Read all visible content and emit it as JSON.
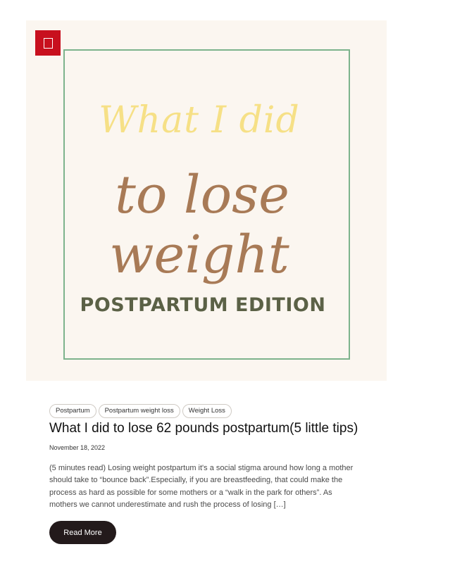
{
  "hero": {
    "line1": "What I did",
    "line2": "to lose",
    "line3": "weight",
    "line4": "POSTPARTUM EDITION",
    "badge_icon": "format-standard-icon",
    "colors": {
      "background": "#fbf6f0",
      "frame": "#7db38c",
      "line1": "#f6e086",
      "line2": "#a87a56",
      "line4": "#5b6146",
      "badge": "#c8101e"
    }
  },
  "post": {
    "tags": [
      "Postpartum",
      "Postpartum weight loss",
      "Weight Loss"
    ],
    "title": "What I did to lose 62 pounds postpartum(5 little tips)",
    "date": "November 18, 2022",
    "excerpt_lines": [
      "(5 minutes read) Losing weight postpartum it's a social stigma around how long a mother",
      "should take to “bounce back”.Especially, if you are breastfeeding, that could make the",
      "process as hard as possible for some mothers or a “walk in the park for others”. As",
      "mothers we cannot underestimate and rush the process of losing […]"
    ],
    "read_more_label": "Read More",
    "read_more_color": "#231a1b"
  }
}
